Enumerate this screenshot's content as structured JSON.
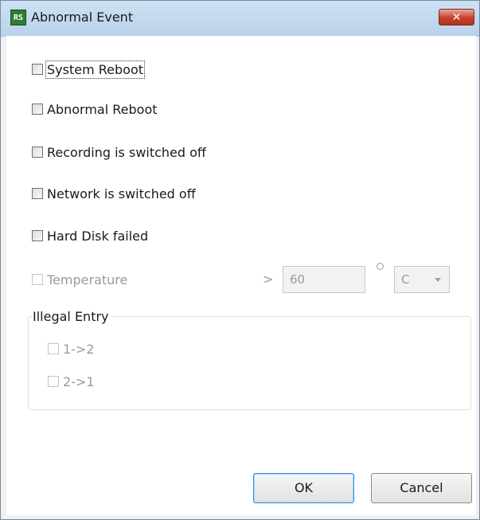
{
  "window": {
    "title": "Abnormal Event",
    "app_icon_text": "RS",
    "close_glyph": "✕"
  },
  "events": [
    {
      "label": "System Reboot",
      "checked": false,
      "enabled": true
    },
    {
      "label": "Abnormal Reboot",
      "checked": false,
      "enabled": true
    },
    {
      "label": "Recording is switched off",
      "checked": false,
      "enabled": true
    },
    {
      "label": "Network is switched off",
      "checked": false,
      "enabled": true
    },
    {
      "label": "Hard Disk failed",
      "checked": false,
      "enabled": true
    }
  ],
  "temperature": {
    "label": "Temperature",
    "checked": false,
    "enabled": false,
    "operator": ">",
    "threshold_value": "60",
    "unit_selected": "C"
  },
  "illegal_entry": {
    "legend": "Illegal Entry",
    "options": [
      {
        "label": "1->2",
        "checked": false,
        "enabled": false
      },
      {
        "label": "2->1",
        "checked": false,
        "enabled": false
      }
    ]
  },
  "buttons": {
    "ok_label": "OK",
    "cancel_label": "Cancel"
  }
}
